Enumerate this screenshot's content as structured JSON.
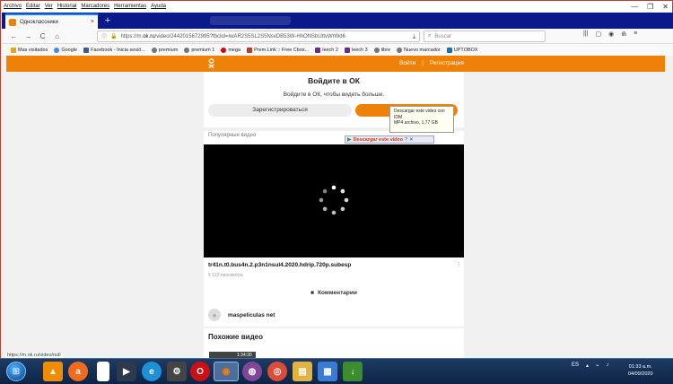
{
  "menubar": {
    "items": [
      "Archivo",
      "Editar",
      "Ver",
      "Historial",
      "Marcadores",
      "Herramientas",
      "Ayuda"
    ]
  },
  "window_controls": {
    "minimize": "—",
    "maximize": "❐",
    "close": "✕"
  },
  "tab": {
    "title": "Одноклассники",
    "close": "×",
    "new_tab": "+"
  },
  "nav": {
    "back": "←",
    "forward": "→",
    "reload": "C",
    "home": "⌂",
    "url_prefix": "https://m.",
    "url_domain": "ok.ru",
    "url_rest": "/video/2442015672995?fbclid=IwAR2S5SL2S5NsvDB53W-HhONSbUttvWrWd6",
    "url_menu": "···",
    "pocket": "▣",
    "star": "☆",
    "search_placeholder": "Buscar",
    "download": "⤓"
  },
  "toolbar_icons": [
    "|||",
    "▢",
    "◉",
    "⋒",
    "≡"
  ],
  "bookmarks": [
    {
      "label": "Mas visitados",
      "color": "#e8a316"
    },
    {
      "label": "Google",
      "color": "#4285f4"
    },
    {
      "label": "Facebook - Inicia sesió...",
      "color": "#3b5998"
    },
    {
      "label": "premium",
      "color": "#777777"
    },
    {
      "label": "premium 1",
      "color": "#777777"
    },
    {
      "label": "mega",
      "color": "#d90007"
    },
    {
      "label": "Prem.Link :: Free Cbox...",
      "color": "#c0392b"
    },
    {
      "label": "leech 2",
      "color": "#6a2c91"
    },
    {
      "label": "leech 3",
      "color": "#6a2c91"
    },
    {
      "label": "libre",
      "color": "#777777"
    },
    {
      "label": "Nuevo marcador",
      "color": "#777777"
    },
    {
      "label": "UPTOBOX",
      "color": "#1a73a8"
    }
  ],
  "ok": {
    "logo": "OK",
    "login_link": "Войти",
    "register_link": "Регистрация",
    "separator": "|",
    "login_title": "Войдите в ОК",
    "login_subtitle": "Войдите в ОК, чтобы видеть больше.",
    "register_button": "Зарегистрироваться",
    "popular_label": "Популярные видео",
    "video_title": "tr41n.t0.bus4n.2.p3n1nsul4.2020.hdrip.720p.subesp",
    "video_views": "5 122 просмотра",
    "more": "⋮",
    "comments": "Комментарии",
    "channel": "maspeliculas net",
    "similar_title": "Похожие видео",
    "thumb_duration": "1:34:30"
  },
  "idm": {
    "play": "▶",
    "label": "Descargar este video",
    "help": "?",
    "close": "✕",
    "tooltip_line1": "Descargar este video con",
    "tooltip_line2": "IDM",
    "tooltip_line3": "MP4 archivo, 1,77 GB"
  },
  "status_url": "https://m.ok.ru/video/null",
  "taskbar": {
    "start": "⊞",
    "apps": [
      {
        "name": "vlc",
        "color": "#f08c00",
        "glyph": "▲"
      },
      {
        "name": "avast",
        "color": "#f26b1d",
        "glyph": "a"
      },
      {
        "name": "notepad",
        "color": "#ffffff",
        "glyph": ""
      },
      {
        "name": "player",
        "color": "#2d3a4d",
        "glyph": "▶"
      },
      {
        "name": "ie",
        "color": "#1e90d6",
        "glyph": "e"
      },
      {
        "name": "tool",
        "color": "#444444",
        "glyph": "⚙"
      },
      {
        "name": "opera",
        "color": "#cc0f16",
        "glyph": "O"
      },
      {
        "name": "firefox",
        "color": "#ff7b00",
        "glyph": "◉"
      },
      {
        "name": "tor",
        "color": "#7e4798",
        "glyph": "◍"
      },
      {
        "name": "chrome",
        "color": "#dd4b39",
        "glyph": "◎"
      },
      {
        "name": "explorer",
        "color": "#e3b341",
        "glyph": "▤"
      },
      {
        "name": "app",
        "color": "#3a7bd5",
        "glyph": "▦"
      },
      {
        "name": "idm",
        "color": "#3c8d2f",
        "glyph": "↓"
      }
    ],
    "language": "ES",
    "tray_icons": [
      "▴",
      "⌁",
      "♪"
    ],
    "time": "01:33 a.m.",
    "date": "04/09/2020"
  }
}
